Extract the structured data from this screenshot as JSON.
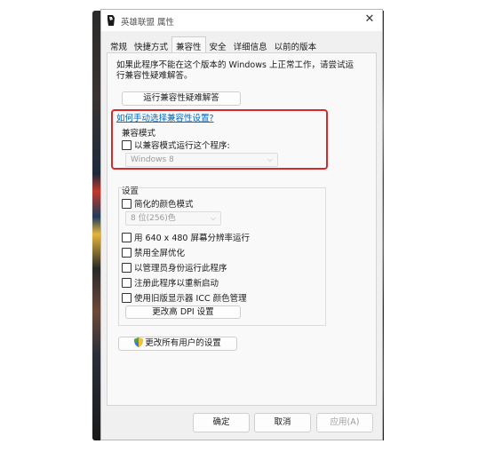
{
  "window": {
    "title": "英雄联盟 属性",
    "close_glyph": "✕"
  },
  "tabs": [
    {
      "label": "常规"
    },
    {
      "label": "快捷方式"
    },
    {
      "label": "兼容性"
    },
    {
      "label": "安全"
    },
    {
      "label": "详细信息"
    },
    {
      "label": "以前的版本"
    }
  ],
  "active_tab": "兼容性",
  "intro_text": "如果此程序不能在这个版本的 Windows 上正常工作，请尝试运行兼容性疑难解答。",
  "troubleshoot_button": "运行兼容性疑难解答",
  "manual_link": "如何手动选择兼容性设置?",
  "compat_mode": {
    "label": "兼容模式",
    "checkbox_label": "以兼容模式运行这个程序:",
    "selected_os": "Windows 8"
  },
  "settings": {
    "label": "设置",
    "reduced_color": "简化的颜色模式",
    "color_select": "8 位(256)色",
    "res_640": "用 640 x 480 屏幕分辨率运行",
    "disable_fullscreen_opt": "禁用全屏优化",
    "run_as_admin": "以管理员身份运行此程序",
    "register_restart": "注册此程序以重新启动",
    "legacy_icc": "使用旧版显示器 ICC 颜色管理",
    "dpi_button": "更改高 DPI 设置"
  },
  "all_users_button": "更改所有用户的设置",
  "footer": {
    "ok": "确定",
    "cancel": "取消",
    "apply": "应用(A)"
  },
  "colors": {
    "highlight_border": "#d62b2b",
    "link": "#0067c0"
  },
  "icons": [
    "app-icon",
    "close-icon",
    "chevron-down-icon",
    "shield-icon"
  ]
}
